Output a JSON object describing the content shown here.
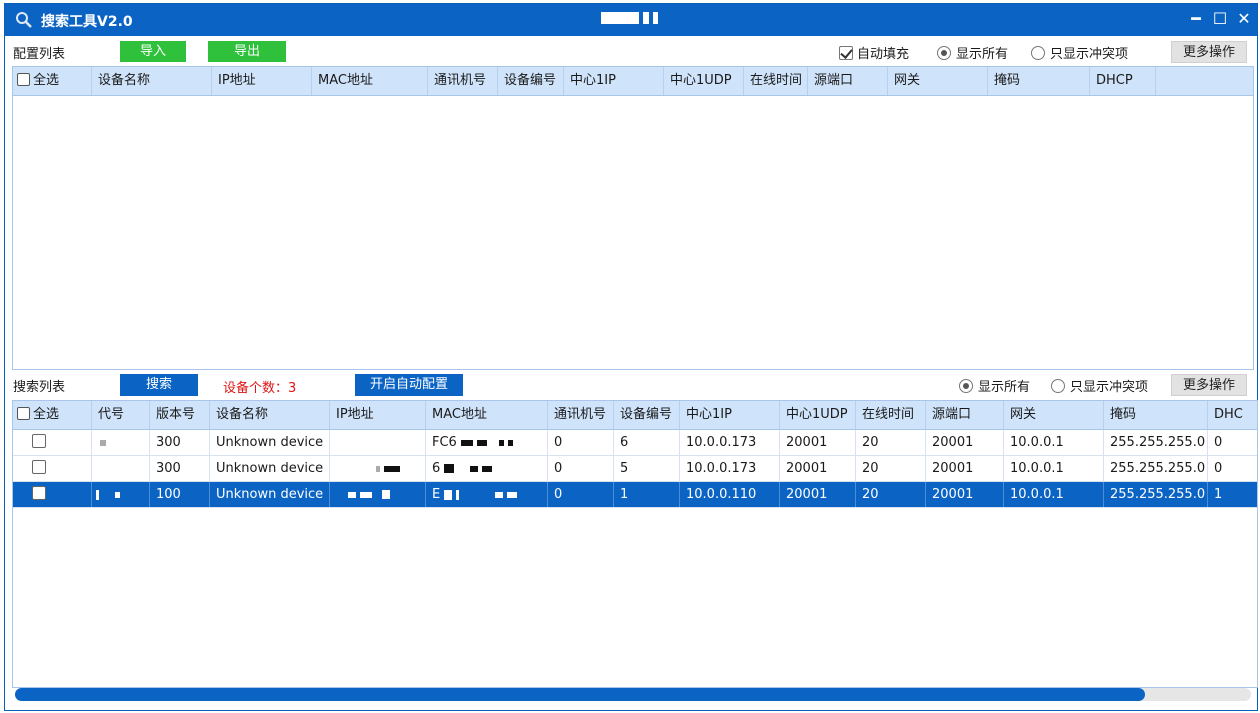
{
  "window": {
    "title": "搜索工具V2.0",
    "controls": {
      "minimize": "━",
      "maximize": "☐",
      "close": "✕"
    }
  },
  "config": {
    "label": "配置列表",
    "import_label": "导入",
    "export_label": "导出",
    "autofill_label": "自动填充",
    "show_all_label": "显示所有",
    "conflict_only_label": "只显示冲突项",
    "more_label": "更多操作",
    "columns": [
      "全选",
      "设备名称",
      "IP地址",
      "MAC地址",
      "通讯机号",
      "设备编号",
      "中心1IP",
      "中心1UDP",
      "在线时间",
      "源端口",
      "网关",
      "掩码",
      "DHCP"
    ]
  },
  "search": {
    "label": "搜索列表",
    "search_label": "搜索",
    "device_count_label": "设备个数：3",
    "auto_config_label": "开启自动配置",
    "show_all_label": "显示所有",
    "conflict_only_label": "只显示冲突项",
    "more_label": "更多操作",
    "columns": [
      "全选",
      "代号",
      "版本号",
      "设备名称",
      "IP地址",
      "MAC地址",
      "通讯机号",
      "设备编号",
      "中心1IP",
      "中心1UDP",
      "在线时间",
      "源端口",
      "网关",
      "掩码",
      "DHC"
    ],
    "rows": [
      {
        "version": "300",
        "name": "Unknown device",
        "mac_prefix": "FC6",
        "comm": "0",
        "dev_no": "6",
        "center_ip": "10.0.0.173",
        "center_udp": "20001",
        "online": "20",
        "src_port": "20001",
        "gateway": "10.0.0.1",
        "mask": "255.255.255.0",
        "dhcp": "0"
      },
      {
        "version": "300",
        "name": "Unknown device",
        "mac_prefix": "6",
        "comm": "0",
        "dev_no": "5",
        "center_ip": "10.0.0.173",
        "center_udp": "20001",
        "online": "20",
        "src_port": "20001",
        "gateway": "10.0.0.1",
        "mask": "255.255.255.0",
        "dhcp": "0"
      },
      {
        "version": "100",
        "name": "Unknown device",
        "mac_prefix": "E",
        "comm": "0",
        "dev_no": "1",
        "center_ip": "10.0.0.110",
        "center_udp": "20001",
        "online": "20",
        "src_port": "20001",
        "gateway": "10.0.0.1",
        "mask": "255.255.255.0",
        "dhcp": "1"
      }
    ]
  },
  "colors": {
    "titlebar": "#0b64c4",
    "header": "#cfe3fa",
    "selected_row": "#0b64c4",
    "green_button": "#2fc13b",
    "count_text": "#e01414"
  }
}
